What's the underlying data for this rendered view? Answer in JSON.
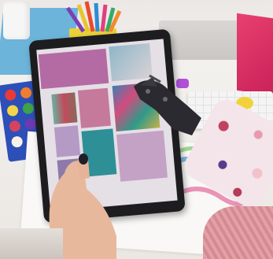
{
  "scene": {
    "description_colors": {
      "desk": "#f1eeea",
      "wall": "#ebe7e4",
      "blue_mat": "#6fb3d8",
      "pink_box": "#e2356a",
      "tablet_body": "#1d1d20",
      "screen_tile_primary": "#b46ba3",
      "screen_tile_teal": "#2f8f96",
      "screen_tile_lavender": "#c3a2c5"
    },
    "icons": [
      "tablet-icon",
      "pencil-cup-icon",
      "watercolor-palette-icon",
      "keyboard-icon",
      "mouse-icon"
    ]
  }
}
